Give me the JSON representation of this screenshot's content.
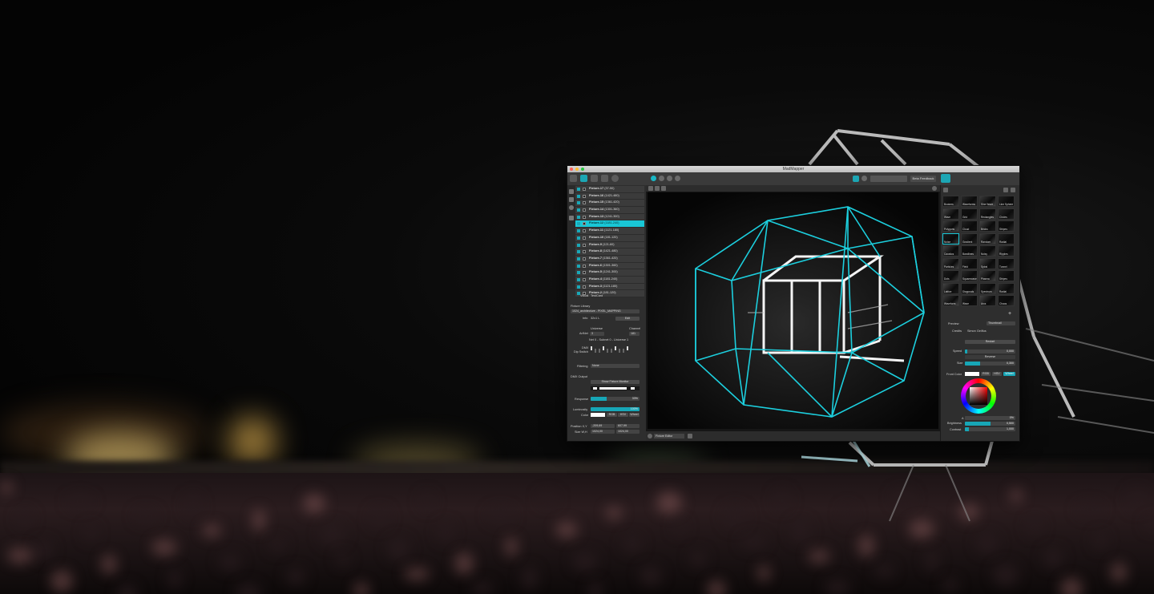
{
  "window": {
    "title": "MadMapper",
    "traffic_lights": [
      "#ff5f57",
      "#febc2e",
      "#28c840"
    ],
    "accent": "#19c7d6"
  },
  "toolbar": {
    "left_icons": [
      "surfaces-icon",
      "fixtures-icon",
      "media-icon",
      "inputs-icon",
      "settings-icon"
    ],
    "center_icons": [
      "select-icon",
      "move-icon",
      "minus-icon",
      "output-icon"
    ],
    "right_icons": [
      "link-icon",
      "eye-icon"
    ],
    "beta_label": "Beta Feedback"
  },
  "fixtures": [
    {
      "name": "Fixture-17",
      "range": "(37-50)"
    },
    {
      "name": "Fixture-16",
      "range": "(1421-480)"
    },
    {
      "name": "Fixture-15",
      "range": "(1361-420)"
    },
    {
      "name": "Fixture-14",
      "range": "(1301-360)"
    },
    {
      "name": "Fixture-13",
      "range": "(1241-300)"
    },
    {
      "name": "Fixture-12",
      "range": "(1181-240)"
    },
    {
      "name": "Fixture-11",
      "range": "(1121-180)"
    },
    {
      "name": "Fixture-10",
      "range": "(181-120)"
    },
    {
      "name": "Fixture-9",
      "range": "(121-60)"
    },
    {
      "name": "Fixture-8",
      "range": "(1421-480)"
    },
    {
      "name": "Fixture-7",
      "range": "(1361-420)"
    },
    {
      "name": "Fixture-6",
      "range": "(1301-360)"
    },
    {
      "name": "Fixture-5",
      "range": "(1241-300)"
    },
    {
      "name": "Fixture-4",
      "range": "(1181-240)"
    },
    {
      "name": "Fixture-3",
      "range": "(1121-180)"
    },
    {
      "name": "Fixture-2",
      "range": "(181-120)"
    }
  ],
  "active_fixture_index": 5,
  "properties": {
    "visual_label": "Visual",
    "visual_value": "TestCard",
    "fixture_library_label": "Fixture Library",
    "fixture_library_value": "1024_architecture - PIXEL_MAPPING",
    "info_label": "Info",
    "info_value": "32x1 L",
    "edit_label": "Edit",
    "universe_label": "Universe",
    "channel_label": "Channel",
    "artnet_label": "ArtNet",
    "universe_value": "3",
    "channel_value": "181",
    "net_info": "Net 0 - Subnet 0 - Universe 1",
    "dmx_label": "DMX",
    "dip_switch_label": "Dip Switch",
    "filtering_label": "Filtering",
    "filtering_value": "None",
    "dmx_output_label": "DMX Output",
    "show_monitor_label": "Show Fixture Monitor",
    "response_label": "Response",
    "response_value": "33%",
    "response_fill": 0.33,
    "luminosity_label": "Luminosity",
    "luminosity_value": "100%",
    "luminosity_fill": 1.0,
    "color_label": "Color",
    "color_modes": [
      "RGB",
      "HSV",
      "Wheel"
    ],
    "position_label": "Position X,Y",
    "position_x": "-209,69",
    "position_y": "607,99",
    "size_label": "Size W,H",
    "size_w": "1024,00",
    "size_h": "1024,00"
  },
  "viewport": {
    "footer_select": "Fixture Editor"
  },
  "media_grid": [
    "Bookers",
    "Waveforms",
    "Sine Wave",
    "Line Sphere",
    "Wave",
    "Grid",
    "Rectangles",
    "Circles",
    "Polygons",
    "Cloud",
    "Bricks",
    "Stripes",
    "Noise",
    "Gradient",
    "Random",
    "Radial",
    "Caustics",
    "Bandlines",
    "Noisy",
    "Ripples",
    "Particles",
    "Field",
    "Spiral",
    "Tunnel",
    "Dots",
    "Squarewave",
    "Plasma",
    "Stripes",
    "Lattice",
    "Diagonals",
    "Spectrum",
    "Radial",
    "Waveform",
    "Wave",
    "Arcs",
    "Chaos"
  ],
  "media_selected_index": 12,
  "media_panel": {
    "preview_label": "Preview",
    "thumbnail_label": "Thumbnail",
    "credits_label": "Credits",
    "credits_value": "Simon Geilfus",
    "restart_label": "Restart",
    "speed_label": "Speed",
    "speed_value": "0,000",
    "speed_fill": 0.05,
    "reverse_label": "Reverse",
    "size_label": "Size",
    "size_value": "0,300",
    "size_fill": 0.3,
    "front_color_label": "Front Color",
    "color_modes": [
      "RGB",
      "HSV",
      "Wheel"
    ],
    "alpha_label": "A",
    "alpha_value": "0%",
    "brightness_label": "Brightness",
    "brightness_value": "0,500",
    "brightness_fill": 0.5,
    "contrast_label": "Contrast",
    "contrast_value": "1,000",
    "contrast_fill": 0.08,
    "add_label": "+"
  }
}
